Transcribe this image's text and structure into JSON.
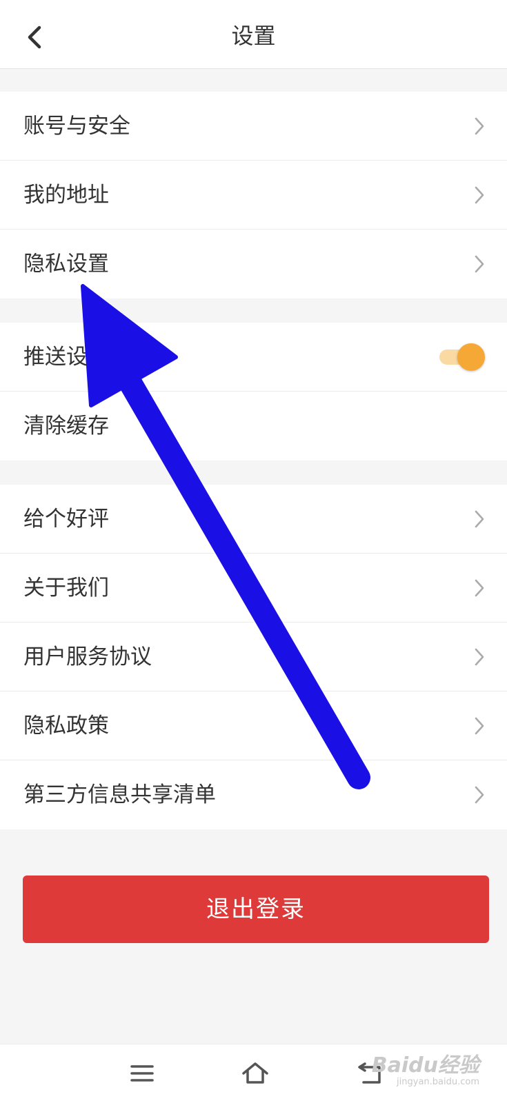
{
  "header": {
    "title": "设置",
    "back_icon": "chevron-left-icon"
  },
  "groups": [
    {
      "items": [
        {
          "label": "账号与安全",
          "icon": "chevron-right-icon"
        },
        {
          "label": "我的地址",
          "icon": "chevron-right-icon"
        },
        {
          "label": "隐私设置",
          "icon": "chevron-right-icon"
        }
      ]
    },
    {
      "items": [
        {
          "label": "推送设置",
          "control": "toggle",
          "checked": true
        },
        {
          "label": "清除缓存",
          "value": ""
        }
      ]
    },
    {
      "items": [
        {
          "label": "给个好评",
          "icon": "chevron-right-icon"
        },
        {
          "label": "关于我们",
          "icon": "chevron-right-icon"
        },
        {
          "label": "用户服务协议",
          "icon": "chevron-right-icon"
        },
        {
          "label": "隐私政策",
          "icon": "chevron-right-icon"
        },
        {
          "label": "第三方信息共享清单",
          "icon": "chevron-right-icon"
        }
      ]
    }
  ],
  "logout": {
    "label": "退出登录"
  },
  "navbar": {
    "items": [
      {
        "icon": "menu-icon"
      },
      {
        "icon": "home-icon"
      },
      {
        "icon": "back-icon"
      }
    ]
  },
  "watermark": {
    "main": "Baidu经验",
    "sub": "jingyan.baidu.com"
  },
  "colors": {
    "accent_toggle": "#f6a836",
    "logout_button": "#df3a3a",
    "annotation_arrow": "#1a10e6",
    "page_background": "#f5f5f5"
  }
}
